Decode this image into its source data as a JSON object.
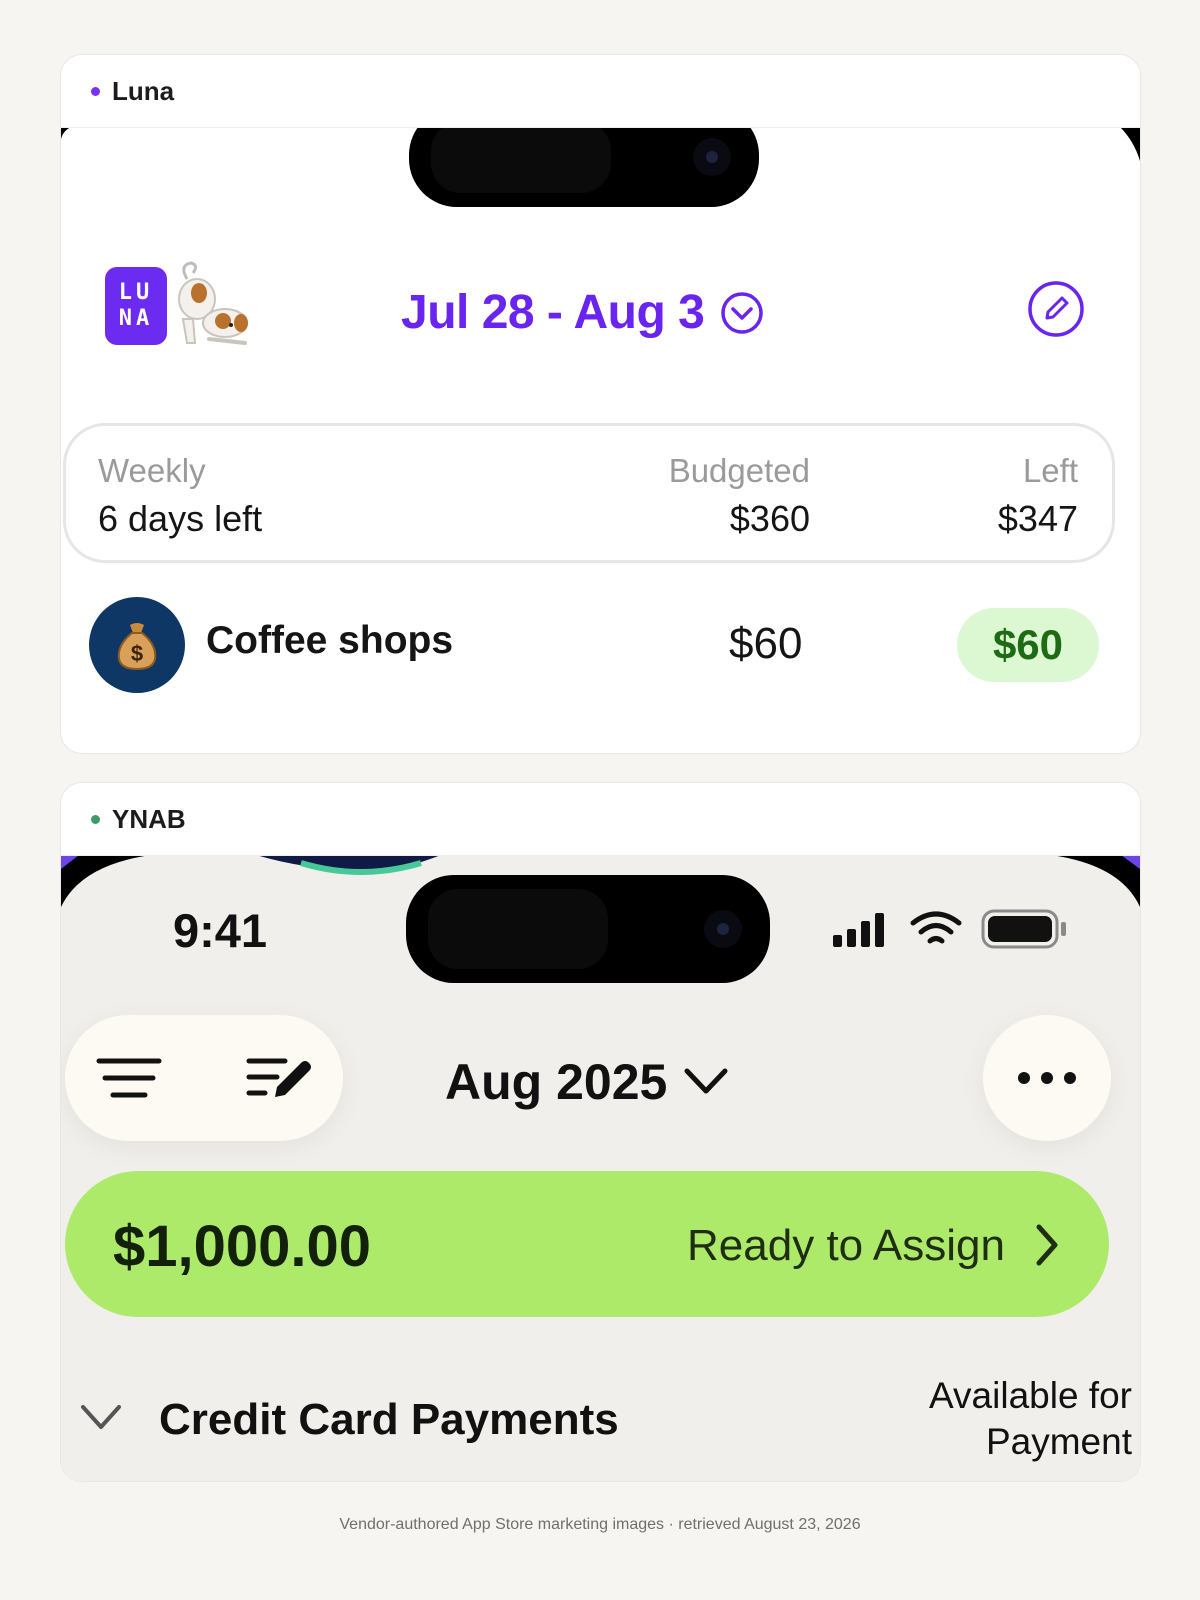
{
  "colors": {
    "luna_dot": "#7b2ff7",
    "ynab_dot": "#3f9a6b",
    "luna_accent": "#6a24ef",
    "ynab_ready_green": "#adea6a",
    "coffee_left_bg": "#dbf8d2"
  },
  "luna": {
    "app_name": "Luna",
    "logo_line1": "LU",
    "logo_line2": "NA",
    "date_range": "Jul 28 - Aug 3",
    "summary": {
      "period_label": "Weekly",
      "period_value": "6 days left",
      "budgeted_label": "Budgeted",
      "budgeted_value": "$360",
      "left_label": "Left",
      "left_value": "$347"
    },
    "category": {
      "icon": "money-bag-icon",
      "name": "Coffee shops",
      "budgeted": "$60",
      "left": "$60"
    }
  },
  "ynab": {
    "app_name": "YNAB",
    "status_time": "9:41",
    "month": "Aug 2025",
    "ready_amount": "$1,000.00",
    "ready_label": "Ready to Assign",
    "group_title": "Credit Card Payments",
    "available_line1": "Available for",
    "available_line2": "Payment"
  },
  "footer": {
    "caption": "Vendor-authored App Store marketing images · retrieved August 23, 2026"
  }
}
